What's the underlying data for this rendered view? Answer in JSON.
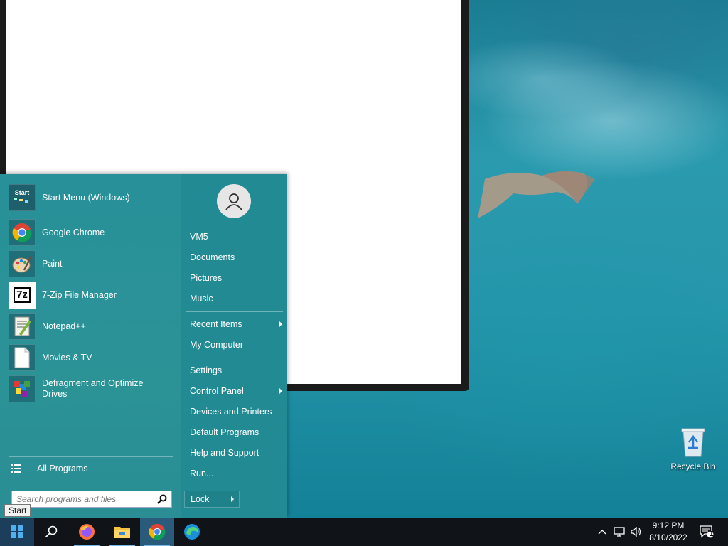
{
  "desktop": {
    "recycle_bin_label": "Recycle Bin"
  },
  "start_menu": {
    "header_item": {
      "label": "Start Menu (Windows)",
      "icon": "start-menu-icon",
      "icon_text": "Start"
    },
    "programs": [
      {
        "label": "Google Chrome",
        "icon": "chrome-icon"
      },
      {
        "label": "Paint",
        "icon": "paint-icon"
      },
      {
        "label": "7-Zip File Manager",
        "icon": "7zip-icon",
        "icon_text": "7z"
      },
      {
        "label": "Notepad++",
        "icon": "notepadpp-icon"
      },
      {
        "label": "Movies & TV",
        "icon": "document-icon"
      },
      {
        "label": "Defragment and Optimize Drives",
        "icon": "defrag-icon"
      }
    ],
    "all_programs_label": "All Programs",
    "search_placeholder": "Search programs and files",
    "right_items": {
      "user": "VM5",
      "documents": "Documents",
      "pictures": "Pictures",
      "music": "Music",
      "recent_items": "Recent Items",
      "my_computer": "My Computer",
      "settings": "Settings",
      "control_panel": "Control Panel",
      "devices_printers": "Devices and Printers",
      "default_programs": "Default Programs",
      "help_support": "Help and Support",
      "run": "Run..."
    },
    "lock_label": "Lock"
  },
  "tooltip": "Start",
  "taskbar": {
    "items": [
      "start-icon",
      "search-icon",
      "firefox-icon",
      "file-explorer-icon",
      "chrome-icon",
      "edge-icon"
    ],
    "active_item": "chrome-icon",
    "clock_time": "9:12 PM",
    "clock_date": "8/10/2022",
    "notification_count": "1"
  },
  "colors": {
    "start_menu_bg": "#2a8a93",
    "taskbar_bg": "#101418",
    "accent": "#76b9ed"
  }
}
